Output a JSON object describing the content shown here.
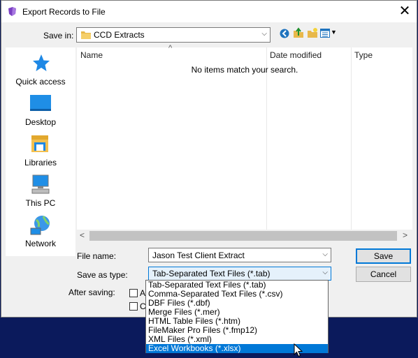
{
  "window": {
    "title": "Export Records to File",
    "close": "✕"
  },
  "toolbar": {
    "save_in_label": "Save in:",
    "save_in_value": "CCD Extracts",
    "icons": [
      "back-icon",
      "up-folder-icon",
      "new-folder-icon",
      "view-menu-icon"
    ]
  },
  "places": [
    {
      "label": "Quick access",
      "icon": "star-icon"
    },
    {
      "label": "Desktop",
      "icon": "desktop-icon"
    },
    {
      "label": "Libraries",
      "icon": "libraries-icon"
    },
    {
      "label": "This PC",
      "icon": "computer-icon"
    },
    {
      "label": "Network",
      "icon": "network-icon"
    }
  ],
  "filelist": {
    "columns": [
      "Name",
      "Date modified",
      "Type"
    ],
    "empty_message": "No items match your search.",
    "scroll_left": "<",
    "scroll_right": ">"
  },
  "form": {
    "file_name_label": "File name:",
    "file_name_value": "Jason Test Client Extract",
    "save_type_label": "Save as type:",
    "save_type_value": "Tab-Separated Text Files (*.tab)",
    "after_saving_label": "After saving:",
    "check1_partial": "Au",
    "check2_partial": "Cr"
  },
  "buttons": {
    "save": "Save",
    "cancel": "Cancel"
  },
  "file_types": [
    "Tab-Separated Text Files (*.tab)",
    "Comma-Separated Text Files (*.csv)",
    "DBF Files (*.dbf)",
    "Merge Files (*.mer)",
    "HTML Table Files (*.htm)",
    "FileMaker Pro Files (*.fmp12)",
    "XML Files (*.xml)",
    "Excel Workbooks (*.xlsx)"
  ],
  "selected_file_type_index": 7,
  "colors": {
    "accent": "#0078d7",
    "desktop_bg": "#0b1a5c",
    "dialog_bg": "#f0f0f0"
  }
}
